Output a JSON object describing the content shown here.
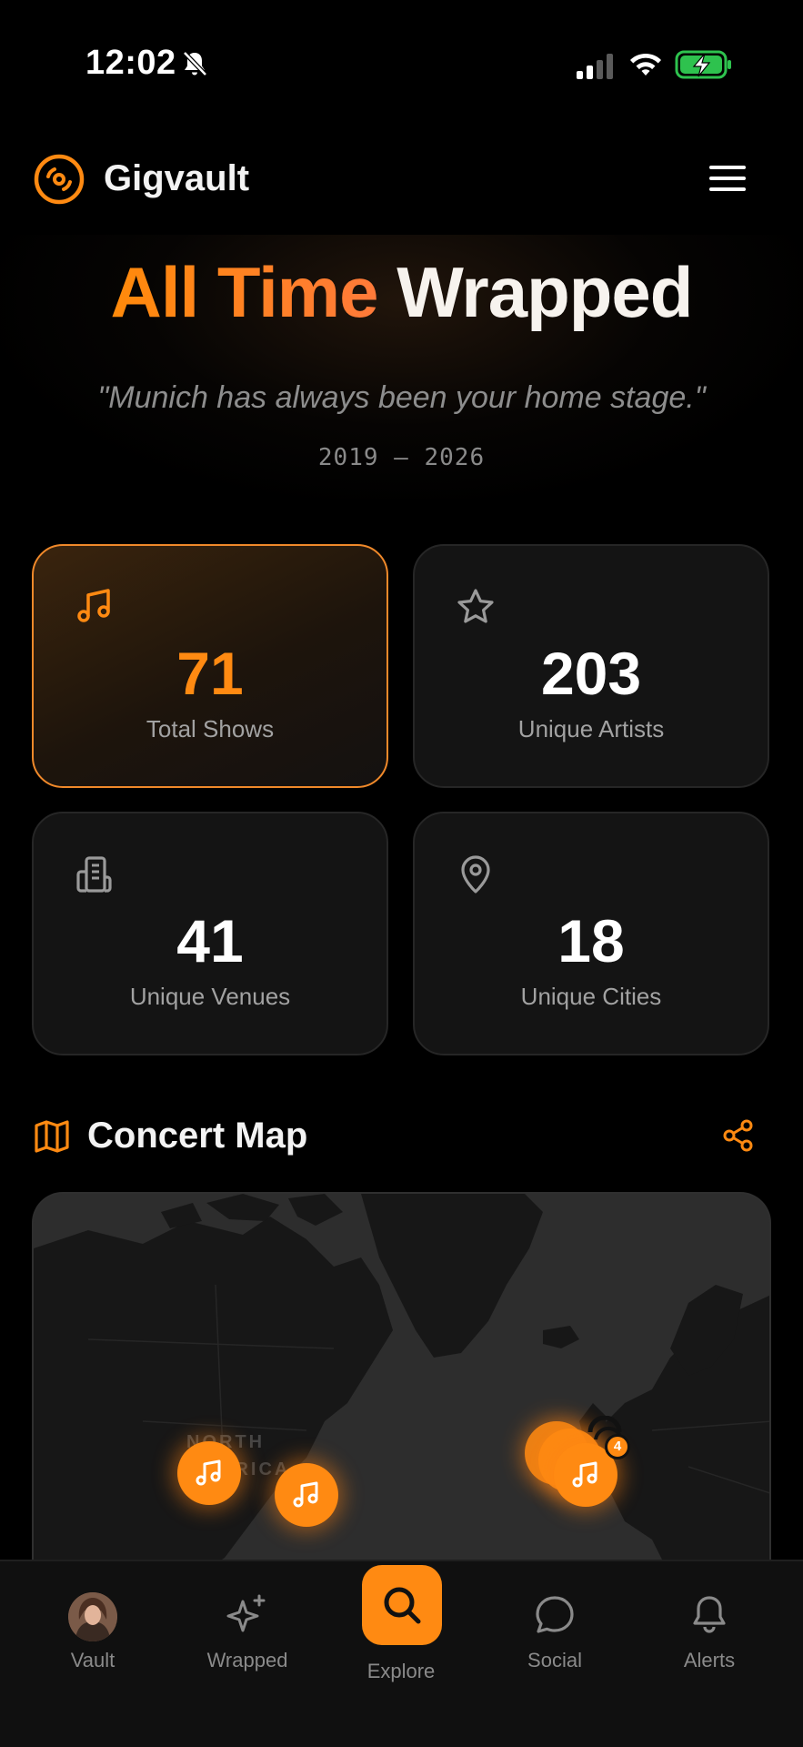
{
  "status_bar": {
    "time": "12:02",
    "icons": [
      "bell-slash-icon",
      "cellular-signal-icon",
      "wifi-icon",
      "battery-charging-icon"
    ]
  },
  "header": {
    "brand": "Gigvault",
    "logo_icon": "vinyl-disc-icon",
    "menu_icon": "hamburger-menu-icon"
  },
  "hero": {
    "title_accent": "All Time",
    "title_main": "Wrapped",
    "quote": "\"Munich has always been your home stage.\"",
    "years": "2019 — 2026"
  },
  "stats": [
    {
      "value": "71",
      "label": "Total Shows",
      "icon": "music-note-icon",
      "active": true
    },
    {
      "value": "203",
      "label": "Unique Artists",
      "icon": "star-icon",
      "active": false
    },
    {
      "value": "41",
      "label": "Unique Venues",
      "icon": "building-icon",
      "active": false
    },
    {
      "value": "18",
      "label": "Unique Cities",
      "icon": "map-pin-icon",
      "active": false
    }
  ],
  "concert_map": {
    "title": "Concert Map",
    "icon": "map-icon",
    "share_icon": "share-icon",
    "region_label_1": "NORTH",
    "region_label_2": "AMERICA",
    "cluster_count": "4"
  },
  "tab_bar": {
    "tabs": [
      {
        "label": "Vault",
        "icon": "avatar"
      },
      {
        "label": "Wrapped",
        "icon": "sparkles-icon"
      },
      {
        "label": "Explore",
        "icon": "search-icon",
        "active": true
      },
      {
        "label": "Social",
        "icon": "chat-bubble-icon"
      },
      {
        "label": "Alerts",
        "icon": "bell-icon"
      }
    ]
  },
  "colors": {
    "accent": "#ff8a12",
    "background": "#000000",
    "card": "#141414",
    "muted_text": "#a2a2a2"
  }
}
